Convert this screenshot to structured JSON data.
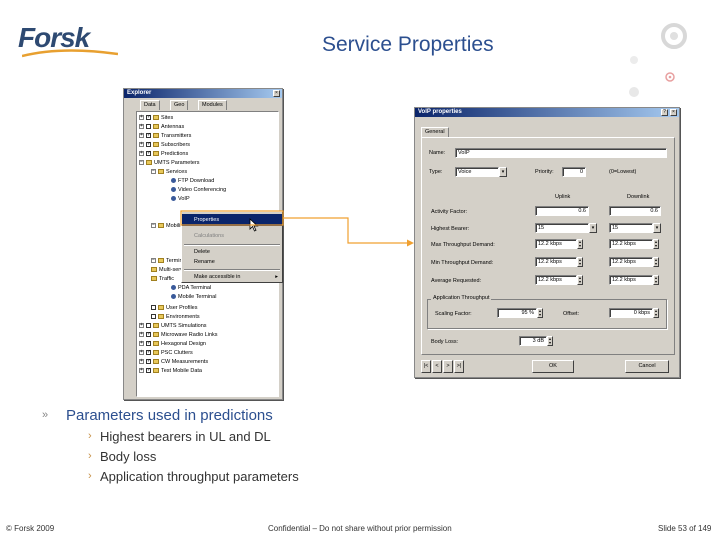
{
  "header": {
    "logo_text": "Forsk",
    "title": "Service Properties"
  },
  "explorer": {
    "title": "Explorer",
    "tabs": [
      "Data",
      "Geo",
      "Modules"
    ],
    "tree": [
      "Sites",
      "Antennas",
      "Transmitters",
      "Subscribers",
      "Predictions",
      "UMTS Parameters",
      "Services",
      "FTP Download",
      "Video Conferencing",
      "VoIP",
      "Mobility",
      "Terminals",
      "Multi-service Traffic",
      "Traffic",
      "PDA Terminal",
      "Mobile Terminal",
      "User Profiles",
      "Environments",
      "UMTS Simulations",
      "Microwave Radio Links",
      "Hexagonal Design",
      "PSC Clutters",
      "CW Measurements",
      "Test Mobile Data"
    ],
    "context_menu": [
      "Properties",
      "Calculations",
      "Delete",
      "Rename",
      "Make accessible in"
    ]
  },
  "dialog": {
    "title": "VoIP properties",
    "tab": "General",
    "name_label": "Name:",
    "name_value": "VoIP",
    "type_label": "Type:",
    "type_value": "Voice",
    "priority_label": "Priority:",
    "priority_value": "0",
    "priority_note": "(0=Lowest)",
    "uplink_header": "Uplink",
    "downlink_header": "Downlink",
    "rows": [
      {
        "label": "Activity Factor:",
        "ul": "0.6",
        "dl": "0.6"
      },
      {
        "label": "Highest Bearer:",
        "ul": "15",
        "dl": "15"
      },
      {
        "label": "Max Throughput Demand:",
        "ul": "12.2 kbps",
        "dl": "12.2 kbps"
      },
      {
        "label": "Min Throughput Demand:",
        "ul": "12.2 kbps",
        "dl": "12.2 kbps"
      },
      {
        "label": "Average Requested:",
        "ul": "12.2 kbps",
        "dl": "12.2 kbps"
      }
    ],
    "app_group": "Application Throughput",
    "scaling_label": "Scaling Factor:",
    "scaling_value": "95 %",
    "offset_label": "Offset:",
    "offset_value": "0 kbps",
    "body_loss_label": "Body Loss:",
    "body_loss_value": "3 dB",
    "nav": [
      "|<",
      "<",
      ">",
      ">|"
    ],
    "ok": "OK",
    "cancel": "Cancel"
  },
  "bullets": {
    "main": "Parameters used in predictions",
    "subs": [
      "Highest bearers in UL and DL",
      "Body loss",
      "Application throughput parameters"
    ]
  },
  "footer": {
    "left": "© Forsk 2009",
    "center": "Confidential – Do not share without prior permission",
    "right": "Slide 53 of 149"
  },
  "colors": {
    "title_blue": "#2c4f8f",
    "connector_orange": "#f0a030",
    "menu_highlight": "#0a246a"
  }
}
